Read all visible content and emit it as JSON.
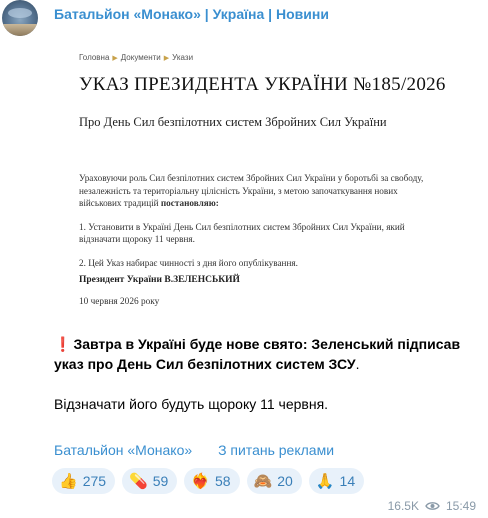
{
  "channel": {
    "name": "Батальйон «Монако» | Україна | Новини"
  },
  "document": {
    "breadcrumb": [
      "Головна",
      "Документи",
      "Укази"
    ],
    "title": "УКАЗ ПРЕЗИДЕНТА УКРАЇНИ №185/2026",
    "subtitle": "Про День Сил безпілотних систем Збройних Сил України",
    "preamble_line1": "Ураховуючи роль Сил безпілотних систем Збройних Сил України у боротьбі за свободу,",
    "preamble_line2": "незалежність та територіальну цілісність України, з метою започаткування нових",
    "preamble_line3_start": "військових традицій ",
    "preamble_line3_bold": "постановляю:",
    "item1_line1": "1. Установити в Україні День Сил безпілотних систем Збройних Сил України, який",
    "item1_line2": "відзначати щороку 11 червня.",
    "item2": "2. Цей Указ набирає чинності з дня його опублікування.",
    "signature": "Президент України В.ЗЕЛЕНСЬКИЙ",
    "date": "10 червня 2026 року"
  },
  "message": {
    "alert_icon": "❗",
    "headline": "Завтра в Україні буде нове свято: Зеленський підписав указ про День Сил безпілотних систем ЗСУ",
    "headline_end": ".",
    "body": "Відзначати його будуть щороку 11 червня."
  },
  "links": {
    "channel": "Батальйон «Монако»",
    "ads": "З питань реклами"
  },
  "reactions": [
    {
      "emoji": "👍",
      "icon": "thumbs-up-icon",
      "count": "275"
    },
    {
      "emoji": "💊",
      "icon": "pill-icon",
      "count": "59"
    },
    {
      "emoji": "❤️‍🔥",
      "icon": "heart-on-fire-icon",
      "count": "58"
    },
    {
      "emoji": "🙈",
      "icon": "see-no-evil-monkey-icon",
      "count": "20"
    },
    {
      "emoji": "🙏",
      "icon": "folded-hands-icon",
      "count": "14"
    }
  ],
  "meta": {
    "views": "16.5K",
    "time": "15:49",
    "views_icon": "eye-icon"
  },
  "colors": {
    "accent": "#3a8fd0",
    "reaction_bg": "#e8f1fa",
    "alert": "#d8232a"
  }
}
